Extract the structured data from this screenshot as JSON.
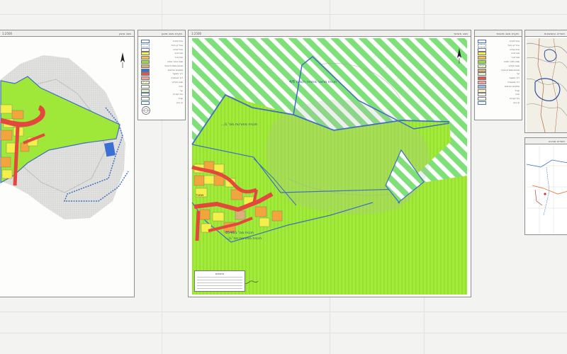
{
  "panels": {
    "left_map": {
      "header": "מצב מוצע",
      "scale": "1:2500"
    },
    "left_legend": {
      "header": "מקרא מצב מוצע",
      "items": [
        {
          "label": "גבול תכנית",
          "color": "#ffffff",
          "pattern": "outline-blue"
        },
        {
          "label": "גבול קו כחול",
          "color": "#ffffff",
          "pattern": "dotted-blue"
        },
        {
          "label": "גבול מגרש",
          "color": "#ffffff",
          "pattern": "outline-gray"
        },
        {
          "label": "מגורים א'",
          "color": "#f3f04a",
          "pattern": "solid"
        },
        {
          "label": "מגורים ב'",
          "color": "#f2c24a",
          "pattern": "solid"
        },
        {
          "label": "שטח ציבורי פתוח",
          "color": "#8fe23a",
          "pattern": "solid"
        },
        {
          "label": "מבנים ומוסדות ציבור",
          "color": "#d9b07a",
          "pattern": "solid"
        },
        {
          "label": "מתקנים הנדסיים",
          "color": "#3a6fd8",
          "pattern": "solid"
        },
        {
          "label": "דרך מוצעת",
          "color": "#e85545",
          "pattern": "solid"
        },
        {
          "label": "דרך מאושרת",
          "color": "#f2a4a4",
          "pattern": "solid"
        },
        {
          "label": "שטח חקלאי",
          "color": "#c8e89a",
          "pattern": "hatch"
        },
        {
          "label": "חניה",
          "color": "#ffffff",
          "pattern": "outline-gray"
        },
        {
          "label": "יער",
          "color": "#dff4c8",
          "pattern": "solid"
        },
        {
          "label": "בית קברות",
          "color": "#ffffff",
          "pattern": "outline-blue"
        },
        {
          "label": "שביל",
          "color": "#ffffff",
          "pattern": "outline-gray"
        },
        {
          "label": "קו בניין",
          "color": "#ffffff",
          "pattern": "outline-blue"
        }
      ]
    },
    "middle_map": {
      "header": "מצב מאושר",
      "scale": "1:2500",
      "labels": {
        "top": "תכנית מתאר מחוזית ת/מ/מ 4/6",
        "center": "תכנית מפורטת מס' ג/...",
        "bottom_a": "תכנית מס' ג/8546",
        "bottom_b": "תכנית מפורטת מס' ג/...",
        "village": "מסגד"
      },
      "stamp_title": "חתימות"
    },
    "right_legend": {
      "header": "מקרא מצב מאושר",
      "items": [
        {
          "label": "גבול תכנית",
          "color": "#ffffff",
          "pattern": "outline-blue"
        },
        {
          "label": "גבול קו כחול",
          "color": "#ffffff",
          "pattern": "dotted-blue"
        },
        {
          "label": "גבול מגרש",
          "color": "#ffffff",
          "pattern": "outline-gray"
        },
        {
          "label": "מגורים א'",
          "color": "#f3f04a",
          "pattern": "solid"
        },
        {
          "label": "מגורים ב'",
          "color": "#f2c24a",
          "pattern": "solid"
        },
        {
          "label": "שטח ציבורי פתוח",
          "color": "#8fe23a",
          "pattern": "solid"
        },
        {
          "label": "שטח חקלאי",
          "color": "#c8e89a",
          "pattern": "hatch"
        },
        {
          "label": "מבנים ומוסדות ציבור",
          "color": "#d9b07a",
          "pattern": "solid"
        },
        {
          "label": "יער",
          "color": "#dff4c8",
          "pattern": "solid"
        },
        {
          "label": "דרך מוצעת",
          "color": "#e85545",
          "pattern": "solid"
        },
        {
          "label": "דרך מאושרת",
          "color": "#f2a4a4",
          "pattern": "solid"
        },
        {
          "label": "מתקנים הנדסיים",
          "color": "#9fb8e8",
          "pattern": "solid"
        },
        {
          "label": "שביל",
          "color": "#fbf3c8",
          "pattern": "solid"
        },
        {
          "label": "חניה",
          "color": "#ffffff",
          "pattern": "outline-gray"
        },
        {
          "label": "בית קברות",
          "color": "#ffffff",
          "pattern": "outline-gray"
        },
        {
          "label": "קו בניין",
          "color": "#ffffff",
          "pattern": "outline-blue"
        }
      ]
    },
    "locator_top": {
      "header": "תשריט התמצאות"
    },
    "locator_bottom": {
      "header": "תשריט סביבה"
    }
  },
  "colors": {
    "approved_green": "#9fe83a",
    "hatch_green": "#7fe07a",
    "residential_yellow": "#f3f04a",
    "residential_orange": "#f2a53a",
    "road_red": "#e4473d",
    "plan_blue": "#3f6fbf",
    "terrain_gray": "#cfcfcf"
  },
  "icons": {
    "north_arrow": "north-arrow-icon",
    "compass_rose": "compass-rose-icon"
  }
}
